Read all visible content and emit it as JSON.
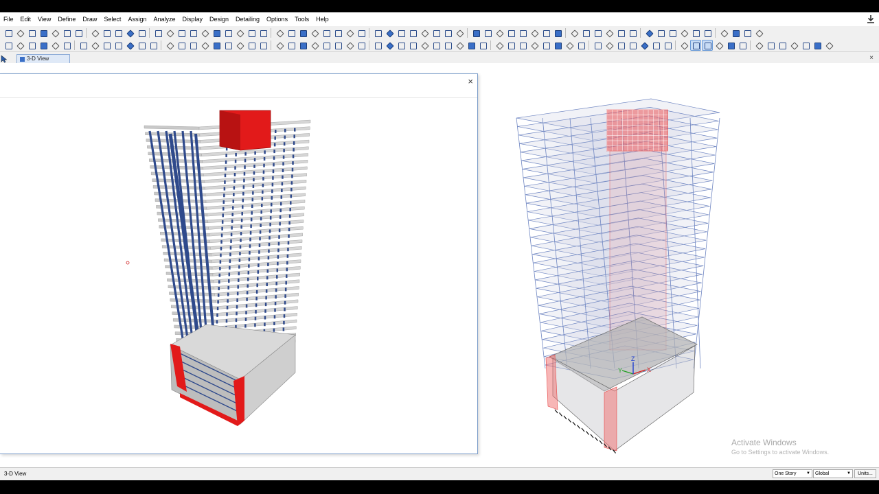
{
  "menubar": {
    "items": [
      "File",
      "Edit",
      "View",
      "Define",
      "Draw",
      "Select",
      "Assign",
      "Analyze",
      "Display",
      "Design",
      "Detailing",
      "Options",
      "Tools",
      "Help"
    ]
  },
  "tabs": [
    {
      "label": "3-D View"
    }
  ],
  "close_glyph": "×",
  "float_window": {
    "close_glyph": "×"
  },
  "watermark": {
    "title": "Activate Windows",
    "subtitle": "Go to Settings to activate Windows."
  },
  "statusbar": {
    "view_label": "3-D View",
    "story_selection": "One Story",
    "coordinate_system": "Global",
    "units_label": "Units..."
  },
  "axes_labels": {
    "x": "X",
    "y": "Y",
    "z": "Z"
  },
  "colors": {
    "column_blue": "#2f4a8c",
    "wall_red": "#e21a1a",
    "slab_gray": "#c9c9c9",
    "wire_blue": "#6f86c2",
    "mesh_red": "#e64545"
  }
}
